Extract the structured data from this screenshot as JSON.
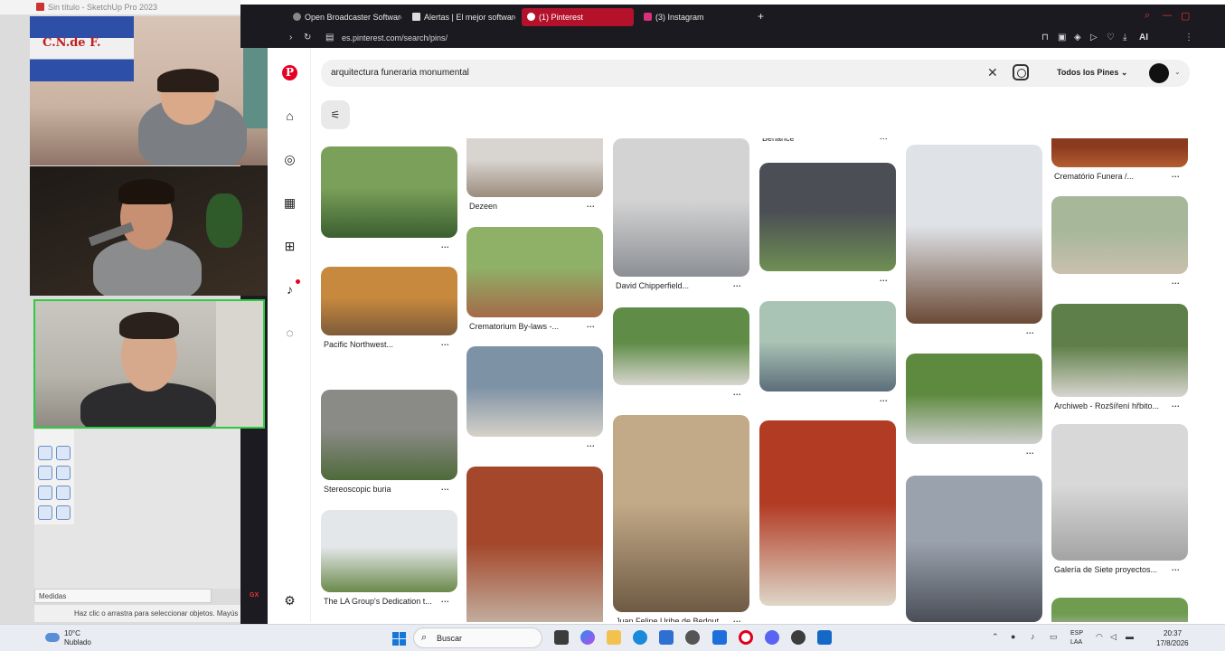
{
  "sketchup": {
    "title": "Sin título - SketchUp Pro 2023",
    "measurements_label": "Medidas",
    "status_text": "Haz clic o arrastra para seleccionar objetos. Mayús = Agregar/Restar. Ctrl = Agregar.",
    "flag_text": "C.N.de F.",
    "gx_label": "GX"
  },
  "browser": {
    "tabs": [
      {
        "label": "Open Broadcaster Software",
        "active": false
      },
      {
        "label": "Alertas | El mejor software",
        "active": false
      },
      {
        "label": "(1) Pinterest",
        "active": true
      },
      {
        "label": "(3) Instagram",
        "active": false
      }
    ],
    "url": "es.pinterest.com/search/pins/",
    "ai_label": "AI"
  },
  "pinterest": {
    "search_query": "arquitectura funeraria monumental",
    "scope_label": "Todos los Pines",
    "columns": [
      {
        "pins": [
          {
            "title": "",
            "colors": [
              "#7aa05a",
              "#3b5e2f"
            ]
          },
          {
            "title": "Pacific Northwest...",
            "colors": [
              "#c7893e",
              "#7d5b3a"
            ]
          },
          {
            "title": "Stereoscopic buria",
            "colors": [
              "#8a8a86",
              "#4e6a3a"
            ]
          },
          {
            "title": "The LA Group's Dedication t...",
            "colors": [
              "#e4e7ea",
              "#6a8a4a"
            ]
          }
        ]
      },
      {
        "pins": [
          {
            "title": "Dezeen",
            "colors": [
              "#d8d4d0",
              "#9c8c7c"
            ]
          },
          {
            "title": "Crematorium By-laws -...",
            "colors": [
              "#8fb067",
              "#a56a49"
            ]
          },
          {
            "title": "",
            "colors": [
              "#7e92a6",
              "#d6d1c8"
            ]
          },
          {
            "title": "",
            "colors": [
              "#a4472a",
              "#c8c2b6"
            ]
          }
        ]
      },
      {
        "pins": [
          {
            "title": "David Chipperfield...",
            "colors": [
              "#d3d3d3",
              "#8c8f94"
            ]
          },
          {
            "title": "",
            "colors": [
              "#5f8c47",
              "#d9d6cf"
            ]
          },
          {
            "title": "Juan Felipe Uribe de Bedout",
            "colors": [
              "#c2a987",
              "#6e5a44"
            ]
          }
        ]
      },
      {
        "pins": [
          {
            "title": "Behance",
            "colors": [
              "#ffffff",
              "#ffffff"
            ]
          },
          {
            "title": "",
            "colors": [
              "#4b4f55",
              "#6f8f53"
            ]
          },
          {
            "title": "",
            "colors": [
              "#a9c3b4",
              "#5c6e7a"
            ]
          },
          {
            "title": "",
            "colors": [
              "#b23b23",
              "#ded7c9"
            ]
          }
        ]
      },
      {
        "pins": [
          {
            "title": "",
            "colors": [
              "#dfe3e8",
              "#6b4a36"
            ]
          },
          {
            "title": "",
            "colors": [
              "#5e8a3f",
              "#cfcfcf"
            ]
          },
          {
            "title": "",
            "colors": [
              "#9aa2ad",
              "#4a4f57"
            ]
          }
        ]
      },
      {
        "pins": [
          {
            "title": "Crematório Funera /...",
            "colors": [
              "#8a3a1e",
              "#b45d30"
            ]
          },
          {
            "title": "",
            "colors": [
              "#a7b89a",
              "#c9c0ae"
            ]
          },
          {
            "title": "Archiweb - Rozšíření hřbito...",
            "colors": [
              "#5e7f49",
              "#d8d5cf"
            ]
          },
          {
            "title": "Galería de Siete proyectos...",
            "colors": [
              "#d8d8d8",
              "#a3a3a3"
            ]
          },
          {
            "title": "",
            "colors": [
              "#6f9c4f",
              "#b6b6b6"
            ]
          }
        ]
      }
    ]
  },
  "taskbar": {
    "temperature": "10°C",
    "weather": "Nublado",
    "search_label": "Buscar",
    "lang_line1": "ESP",
    "lang_line2": "LAA",
    "time": "20:37",
    "date": "17/8/2026"
  }
}
